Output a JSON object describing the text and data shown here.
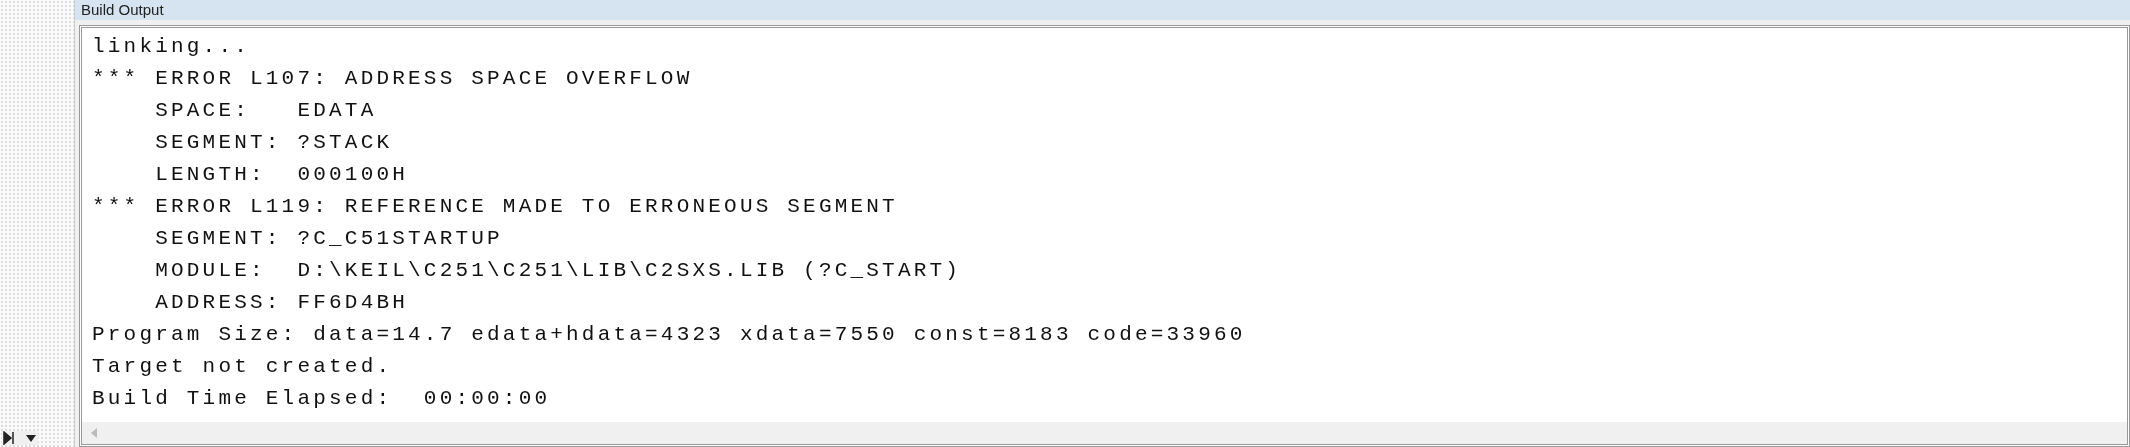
{
  "window": {
    "title": "Build Output"
  },
  "output_lines": [
    "linking...",
    "*** ERROR L107: ADDRESS SPACE OVERFLOW",
    "    SPACE:   EDATA",
    "    SEGMENT: ?STACK",
    "    LENGTH:  000100H",
    "*** ERROR L119: REFERENCE MADE TO ERRONEOUS SEGMENT",
    "    SEGMENT: ?C_C51STARTUP",
    "    MODULE:  D:\\KEIL\\C251\\C251\\LIB\\C2SXS.LIB (?C_START)",
    "    ADDRESS: FF6D4BH",
    "Program Size: data=14.7 edata+hdata=4323 xdata=7550 const=8183 code=33960",
    "Target not created.",
    "Build Time Elapsed:  00:00:00"
  ]
}
